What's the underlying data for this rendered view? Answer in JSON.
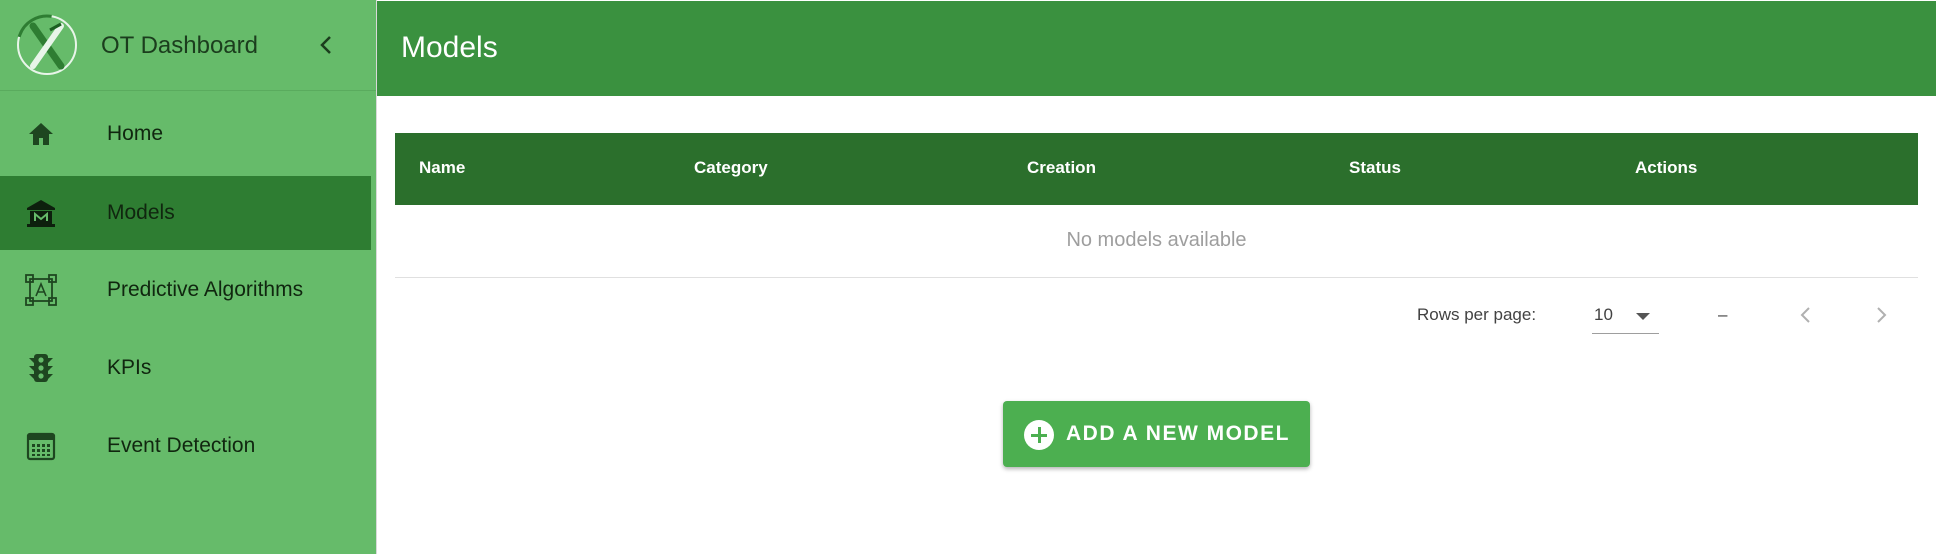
{
  "app": {
    "title": "OT Dashboard"
  },
  "sidebar": {
    "items": [
      {
        "label": "Home",
        "icon": "home-icon",
        "active": false
      },
      {
        "label": "Models",
        "icon": "museum-icon",
        "active": true
      },
      {
        "label": "Predictive Algorithms",
        "icon": "bounding-box-icon",
        "active": false
      },
      {
        "label": "KPIs",
        "icon": "traffic-light-icon",
        "active": false
      },
      {
        "label": "Event Detection",
        "icon": "calendar-grid-icon",
        "active": false
      }
    ]
  },
  "header": {
    "title": "Models"
  },
  "table": {
    "columns": [
      "Name",
      "Category",
      "Creation",
      "Status",
      "Actions"
    ],
    "empty_message": "No models available"
  },
  "pagination": {
    "rows_per_page_label": "Rows per page:",
    "rows_per_page_value": "10",
    "range_text": "–"
  },
  "actions": {
    "add_label": "ADD A NEW MODEL"
  },
  "colors": {
    "sidebar": "#66bb6a",
    "active_item": "#2e7d32",
    "topbar": "#3a913f",
    "table_header": "#2b6f2c",
    "add_button": "#4caf50"
  }
}
